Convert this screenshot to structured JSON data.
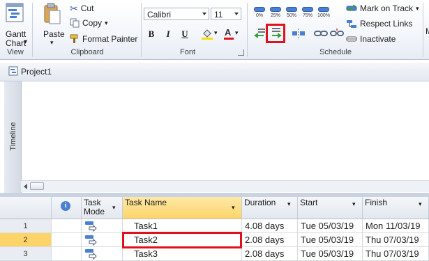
{
  "ribbon": {
    "view": {
      "gantt_label_1": "Gantt",
      "gantt_label_2": "Chart",
      "dropdown": "▾",
      "group": "View"
    },
    "clipboard": {
      "paste": "Paste",
      "cut": "Cut",
      "copy": "Copy",
      "format_painter": "Format Painter",
      "group": "Clipboard"
    },
    "font": {
      "family": "Calibri",
      "size": "11",
      "bold": "B",
      "italic": "I",
      "underline": "U",
      "font_color_letter": "A",
      "group": "Font"
    },
    "schedule": {
      "pct": [
        "0%",
        "25%",
        "50%",
        "75%",
        "100%"
      ],
      "mark_on_track": "Mark on Track",
      "respect_links": "Respect Links",
      "inactivate": "Inactivate",
      "group": "Schedule"
    },
    "next_group_fragment": "M"
  },
  "project": {
    "title": "Project1"
  },
  "timeline": {
    "label": "Timeline"
  },
  "grid": {
    "columns": {
      "info": "i",
      "task_mode": "Task Mode",
      "task_name": "Task Name",
      "duration": "Duration",
      "start": "Start",
      "finish": "Finish"
    },
    "rows": [
      {
        "num": "1",
        "name": "Task1",
        "duration": "4.08 days",
        "start": "Tue 05/03/19",
        "finish": "Mon 11/03/19"
      },
      {
        "num": "2",
        "name": "Task2",
        "duration": "2.08 days",
        "start": "Tue 05/03/19",
        "finish": "Thu 07/03/19"
      },
      {
        "num": "3",
        "name": "Task3",
        "duration": "2.08 days",
        "start": "Tue 05/03/19",
        "finish": "Thu 07/03/19"
      }
    ],
    "selected_row": 2
  },
  "colors": {
    "accent_blue": "#4b7fd1",
    "selection_yellow": "#fdd46a",
    "highlight_red": "#e0111c"
  }
}
